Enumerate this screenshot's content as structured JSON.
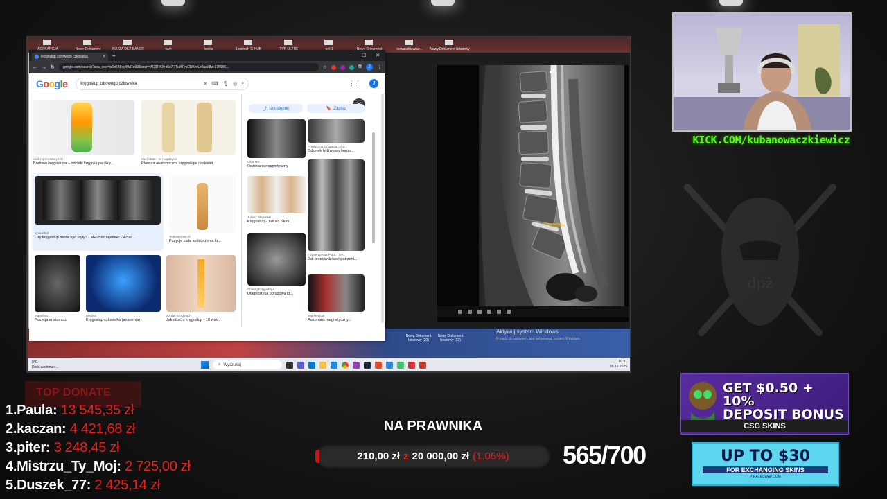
{
  "desktop_icons": [
    "ADSKANCJA",
    "Nowy Dokument",
    "BLUZA DEZ BANER",
    "tawi",
    "koska",
    "Logitech G HUB",
    "TVP ULTRE",
    "pet 1",
    "Nowy Dokument",
    "nowaczkiewicz...",
    "Nowy Dokument tekstowy"
  ],
  "browser": {
    "tab_title": "kręgosłup zdrowego człowieka",
    "url": "google.com/search?sca_esv=fa0d648ec49d7a99&sxsrf=AE3TifOh46c7I7TuI5FrsCNKnrUr0ua08w:175996...",
    "logo": "Google",
    "search_query": "kręgosłup zdrowego człowieka",
    "avatar_letter": "J"
  },
  "results": [
    {
      "src": "Andrzej Kroszczyński",
      "title": "Budowa kręgosłupa – odcinki kręgosłupa i krę..."
    },
    {
      "src": "Med Store · W magazynie",
      "title": "Plansza anatomiczna kręgosłupa i szkielet..."
    },
    {
      "src": "Acus Med",
      "title": "Czy kręgosłup może być otyły? - MRI bez tajemnic - Acus ..."
    },
    {
      "src": "Testosterone.pl",
      "title": "Pozycje ciała a obciążenia kr..."
    },
    {
      "src": "Magnifixx",
      "title": "Pozycja anatomicz"
    },
    {
      "src": "Medina",
      "title": "Kręgosłup człowieka (anatomia)"
    },
    {
      "src": "Szpital na Klinach",
      "title": "Jak dbać o kręgosłup - 10 wsk..."
    }
  ],
  "panel": {
    "share_label": "Udostępnij",
    "save_label": "Zapisz",
    "items": [
      {
        "src": "Ultra MR",
        "title": "Rezonans magnetyczny"
      },
      {
        "src": "Praktyczna Ortopedia i Tra...",
        "title": "Odcinek lędźwiowy kręgo..."
      },
      {
        "src": "Juliusz Słonimski",
        "title": "Kręgosłup - Juliusz Słoni..."
      },
      {
        "src": "Fizjoterapeuta Płock | Tre...",
        "title": "Jak przeciwdziałać patrzeni..."
      },
      {
        "src": "Chirurg Kręgosłupa",
        "title": "Diagnostyka obrazowa kr..."
      },
      {
        "src": "Top Medical",
        "title": "Rezonans magnetyczny..."
      }
    ]
  },
  "mri_measurement": "3.25 mm",
  "windows": {
    "activate_title": "Aktywuj system Windows",
    "activate_sub": "Przejdź do ustawień, aby aktywować system Windows.",
    "desk_doc1": "Nowy Dokument tekstowy (20)",
    "desk_doc2": "Nowy Dokument tekstowy (22)",
    "weather_temp": "8°C",
    "weather_desc": "Dość zachmurz...",
    "search_placeholder": "Wyszukaj",
    "clock_time": "01:11",
    "clock_date": "09.10.2025"
  },
  "kick_url": "KICK.COM/kubanowaczkiewicz",
  "ads": {
    "ad1_line1": "GET $0.50 + 10%",
    "ad1_line2": "DEPOSIT BONUS",
    "ad1_brand": "CSG SKINS",
    "ad2_big": "UP TO $30",
    "ad2_small": "FOR EXCHANGING SKINS",
    "ad2_tiny": "PIRATESWAP.COM"
  },
  "top_donate": {
    "label": "TOP DONATE",
    "donors": [
      {
        "rank": "1.",
        "name": "Paula:",
        "amount": "13 545,35 zł"
      },
      {
        "rank": "2.",
        "name": "kaczan:",
        "amount": "4 421,68 zł"
      },
      {
        "rank": "3.",
        "name": "piter:",
        "amount": "3 248,45 zł"
      },
      {
        "rank": "4.",
        "name": "Mistrzu_Ty_Moj:",
        "amount": "2 725,00 zł"
      },
      {
        "rank": "5.",
        "name": "Duszek_77:",
        "amount": "2 425,14 zł"
      }
    ]
  },
  "goal": {
    "title": "NA PRAWNIKA",
    "current": "210,00 zł",
    "separator": "z",
    "target": "20 000,00 zł",
    "percent": "(1.05%)"
  },
  "subs_counter": "565/700"
}
